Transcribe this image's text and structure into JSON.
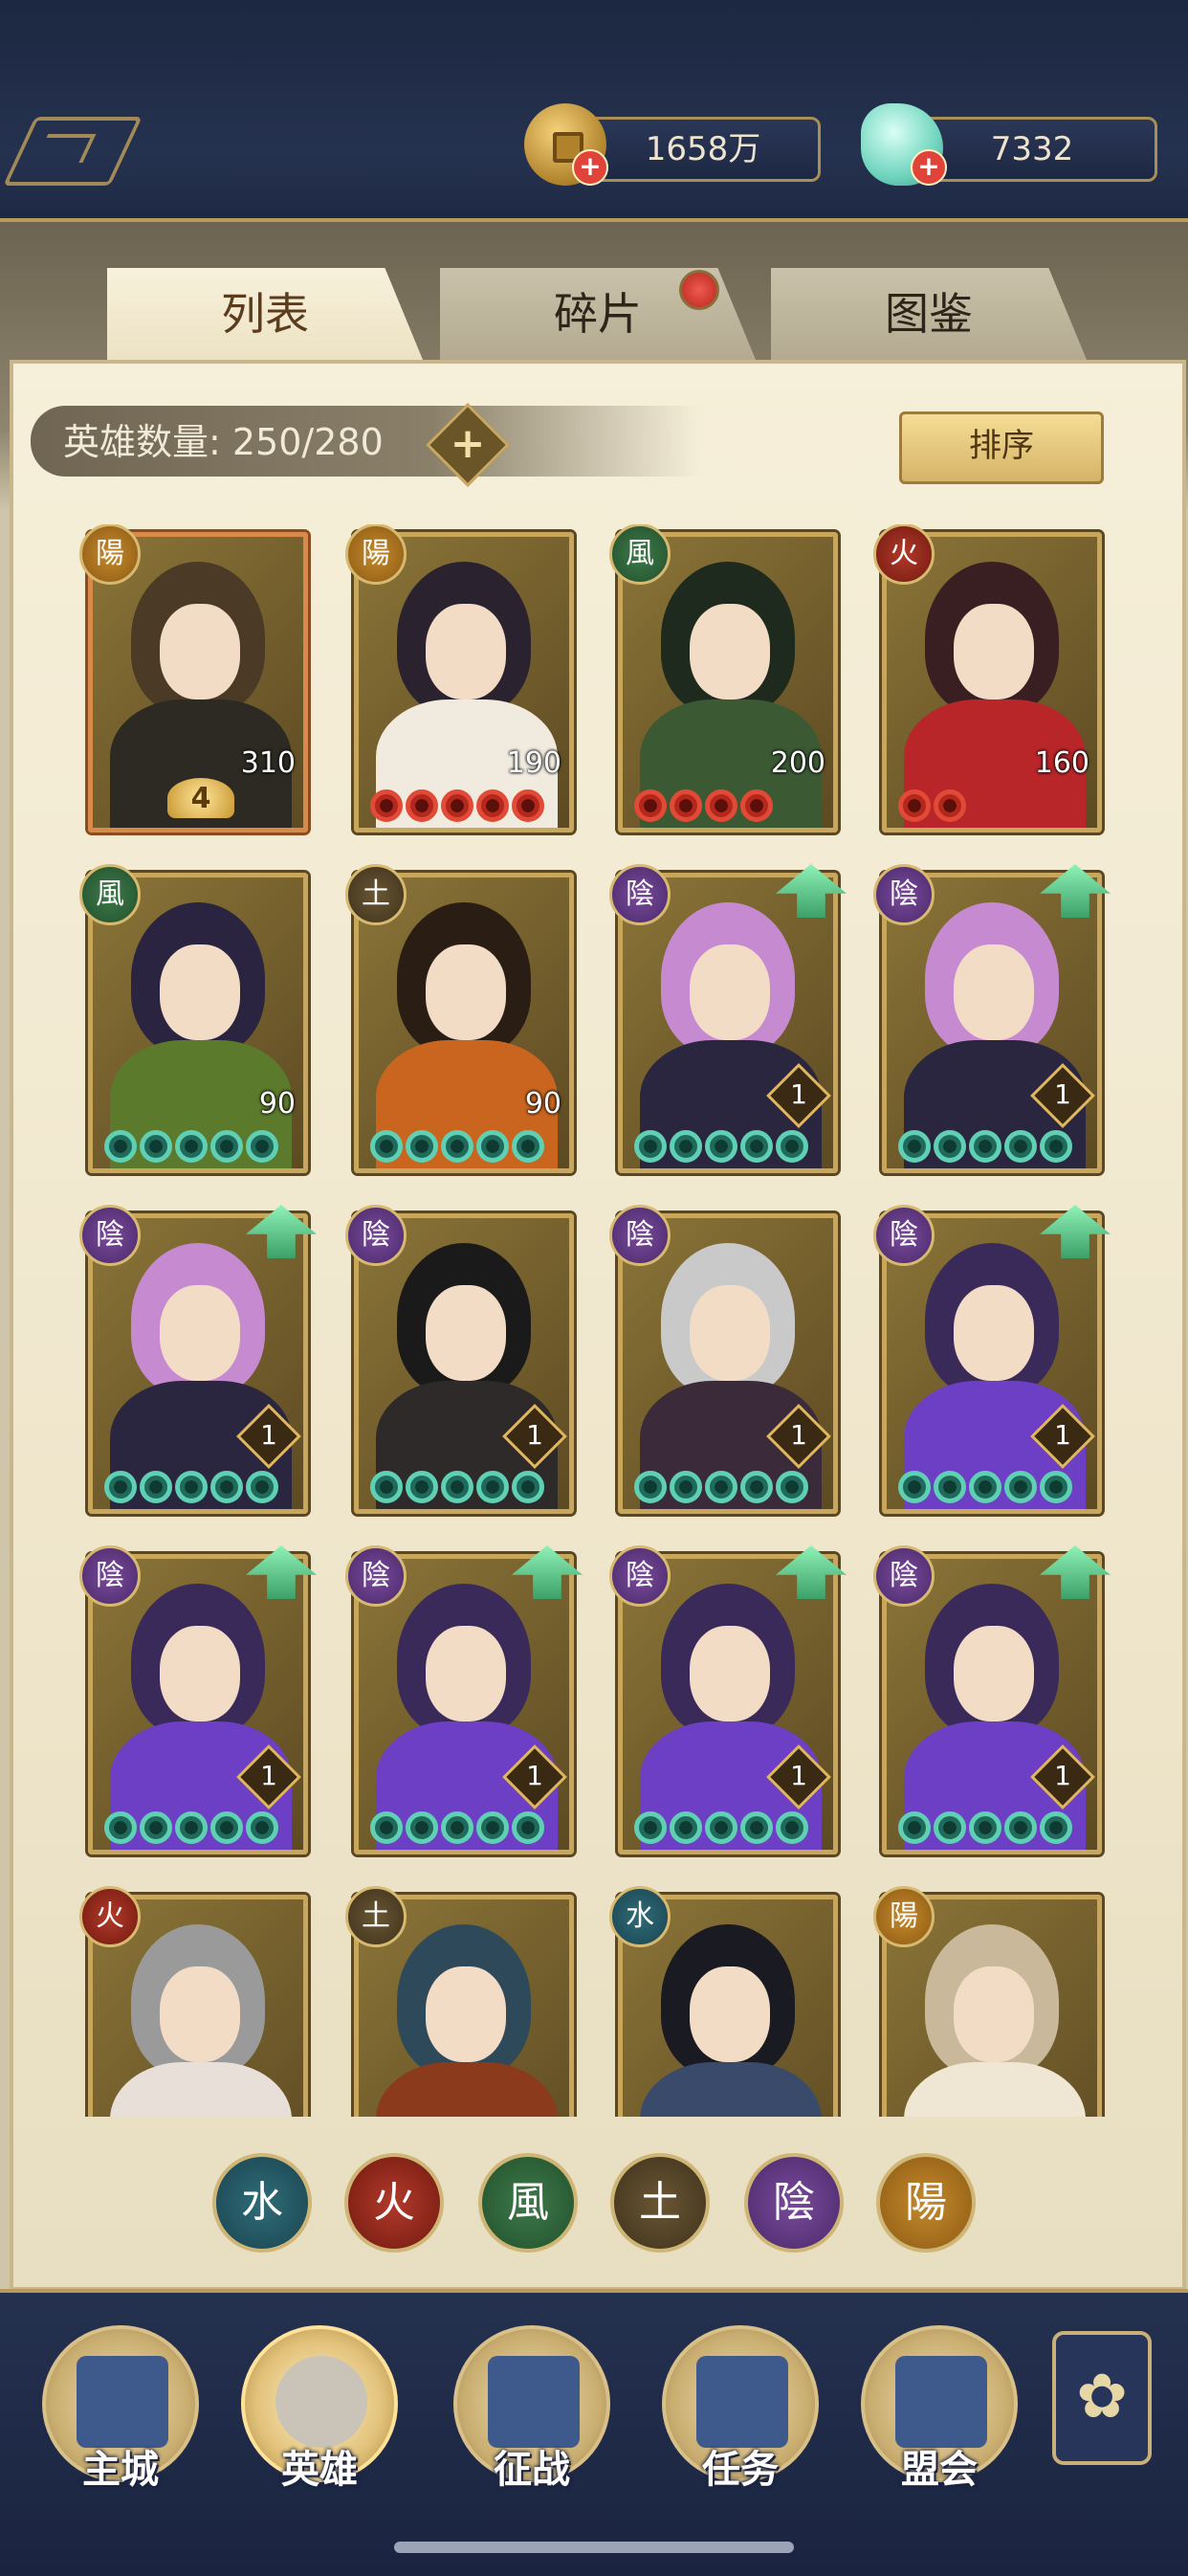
{
  "currency": {
    "coins": "1658万",
    "jade": "7332",
    "plus": "+"
  },
  "tabs": [
    {
      "label": "列表",
      "active": true
    },
    {
      "label": "碎片",
      "active": false,
      "has_notification": true
    },
    {
      "label": "图鉴",
      "active": false
    }
  ],
  "hero_count": {
    "label": "英雄数量: 250/280",
    "plus": "+"
  },
  "sort_label": "排序",
  "element_glyphs": {
    "yang": "陽",
    "yin": "陰",
    "wind": "風",
    "fire": "火",
    "earth": "土",
    "water": "水"
  },
  "heroes": [
    {
      "element": "陽",
      "level": "310",
      "stars": 0,
      "star_color": "none",
      "star_badge": "4",
      "upgrade": false
    },
    {
      "element": "陽",
      "level": "190",
      "stars": 5,
      "star_color": "red",
      "upgrade": false
    },
    {
      "element": "風",
      "level": "200",
      "stars": 4,
      "star_color": "red",
      "upgrade": false
    },
    {
      "element": "火",
      "level": "160",
      "stars": 2,
      "star_color": "red",
      "upgrade": false
    },
    {
      "element": "風",
      "level": "90",
      "stars": 5,
      "star_color": "jade",
      "upgrade": false
    },
    {
      "element": "土",
      "level": "90",
      "stars": 5,
      "star_color": "jade",
      "upgrade": false
    },
    {
      "element": "陰",
      "level": "1",
      "stars": 5,
      "star_color": "jade",
      "upgrade": true
    },
    {
      "element": "陰",
      "level": "1",
      "stars": 5,
      "star_color": "jade",
      "upgrade": true
    },
    {
      "element": "陰",
      "level": "1",
      "stars": 5,
      "star_color": "jade",
      "upgrade": true
    },
    {
      "element": "陰",
      "level": "1",
      "stars": 5,
      "star_color": "jade",
      "upgrade": false
    },
    {
      "element": "陰",
      "level": "1",
      "stars": 5,
      "star_color": "jade",
      "upgrade": false
    },
    {
      "element": "陰",
      "level": "1",
      "stars": 5,
      "star_color": "jade",
      "upgrade": true
    },
    {
      "element": "陰",
      "level": "1",
      "stars": 5,
      "star_color": "jade",
      "upgrade": true
    },
    {
      "element": "陰",
      "level": "1",
      "stars": 5,
      "star_color": "jade",
      "upgrade": true
    },
    {
      "element": "陰",
      "level": "1",
      "stars": 5,
      "star_color": "jade",
      "upgrade": true
    },
    {
      "element": "陰",
      "level": "1",
      "stars": 5,
      "star_color": "jade",
      "upgrade": true
    },
    {
      "element": "火",
      "level": "",
      "stars": 0,
      "star_color": "none",
      "upgrade": false
    },
    {
      "element": "土",
      "level": "",
      "stars": 0,
      "star_color": "none",
      "upgrade": false
    },
    {
      "element": "水",
      "level": "",
      "stars": 0,
      "star_color": "none",
      "upgrade": false
    },
    {
      "element": "陽",
      "level": "",
      "stars": 0,
      "star_color": "none",
      "upgrade": false
    }
  ],
  "filters": [
    "水",
    "火",
    "風",
    "土",
    "陰",
    "陽"
  ],
  "nav": [
    {
      "label": "主城",
      "active": false
    },
    {
      "label": "英雄",
      "active": true
    },
    {
      "label": "征战",
      "active": false
    },
    {
      "label": "任务",
      "active": false
    },
    {
      "label": "盟会",
      "active": false
    }
  ]
}
